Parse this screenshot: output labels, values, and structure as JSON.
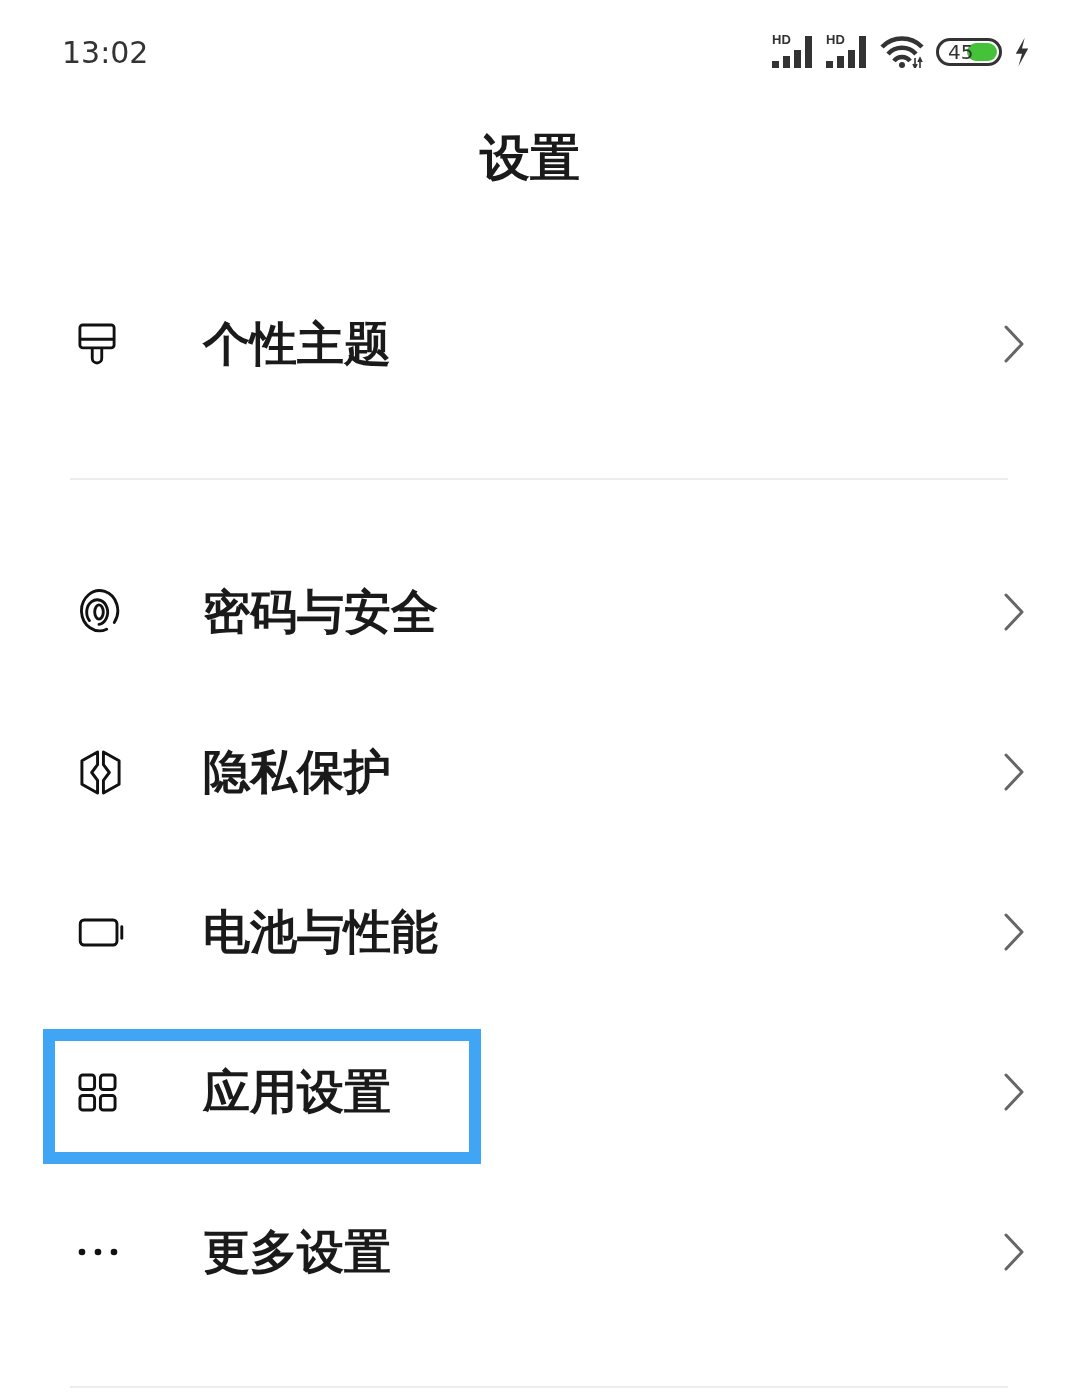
{
  "status_bar": {
    "time": "13:02",
    "signals": [
      {
        "network_type": "HD"
      },
      {
        "network_type": "HD"
      }
    ],
    "battery": {
      "percent": "45"
    }
  },
  "title": "设置",
  "groups": [
    {
      "items": [
        {
          "label": "个性主题",
          "highlighted": false
        }
      ]
    },
    {
      "items": [
        {
          "label": "密码与安全",
          "highlighted": false
        },
        {
          "label": "隐私保护",
          "highlighted": false
        },
        {
          "label": "电池与性能",
          "highlighted": false
        },
        {
          "label": "应用设置",
          "highlighted": true
        },
        {
          "label": "更多设置",
          "highlighted": false
        }
      ]
    }
  ]
}
